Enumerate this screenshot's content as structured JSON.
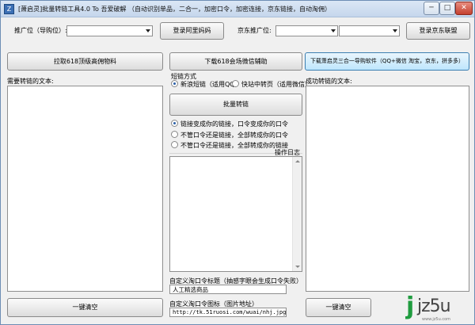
{
  "window": {
    "title": "[萧启灵]批量转链工具4.0 To 吾爱破解 （自动识别单品，二合一，加密口令，加密连接，京东链接，自动淘佣）",
    "icon_letter": "Z",
    "min_glyph": "─",
    "max_glyph": "□",
    "close_glyph": "✕"
  },
  "promo": {
    "label": "推广位（导购位）:",
    "select_value": "",
    "login_ali_button": "登录阿里妈妈"
  },
  "jd": {
    "label": "京东推广位:",
    "select1_value": "",
    "select2_value": "",
    "login_jd_button": "登录京东联盟"
  },
  "buttons": {
    "fetch_618": "拉取618顶级高佣物料",
    "download_618_wechat": "下载618会场微信辅助",
    "download_3in1": "下载萧启灵三合一导购软件（QQ+微信 淘宝，京东，拼多多）",
    "batch_convert": "批量转链",
    "clear_left": "一键清空",
    "clear_right": "一键清空"
  },
  "left_panel": {
    "label": "需要转链的文本:"
  },
  "right_panel": {
    "label": "成功转链的文本:"
  },
  "convert_mode": {
    "label": "短链方式",
    "options": [
      {
        "label": "新浪短链（适用QQ）",
        "selected": true
      },
      {
        "label": "快站中转页（适用微信）",
        "selected": false
      }
    ]
  },
  "output_mode": {
    "options": [
      {
        "label": "链接变成你的链接，口令变成你的口令",
        "selected": true
      },
      {
        "label": "不管口令还是链接，全部转成你的口令",
        "selected": false
      },
      {
        "label": "不管口令还是链接，全部转成你的链接",
        "selected": false
      }
    ]
  },
  "log": {
    "label": "操作日志"
  },
  "custom_title": {
    "label": "自定义淘口令标题（抽感字眼会生成口令失败）",
    "value": "人工精选商品"
  },
  "custom_icon": {
    "label": "自定义淘口令图标（图片地址）",
    "value": "http://tk.51ruosi.com/wuai/nhj.jpg"
  },
  "watermark": {
    "letter": "j",
    "text": "jz5u",
    "sub": "www.jz5u.com"
  }
}
